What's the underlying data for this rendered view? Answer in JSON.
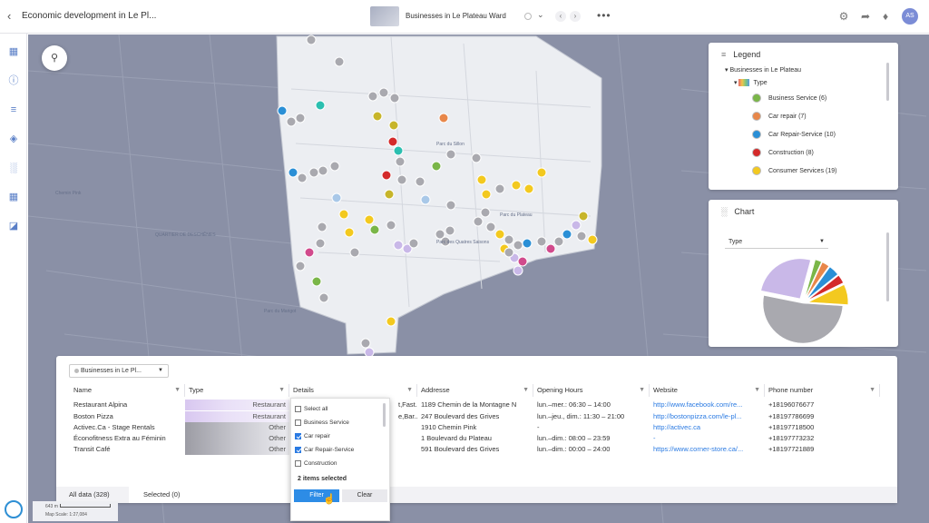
{
  "header": {
    "title": "Economic development in Le Pl...",
    "map_name": "Businesses in Le Plateau Ward",
    "user_initials": "AS"
  },
  "map": {
    "scale_distance": "643 m",
    "scale_label": "Map Scale: 1:27,084",
    "place_labels": [
      "Chemin Pink",
      "Parc du Sillon",
      "QUARTIER DE DESCHÊNES",
      "Parc du Plateau",
      "Parc des Quatres Saisons",
      "Parc du Marigot"
    ]
  },
  "legend": {
    "title": "Legend",
    "group": "Businesses in Le Plateau",
    "type_label": "Type",
    "items": [
      {
        "label": "Business Service (6)",
        "color": "#7ab648"
      },
      {
        "label": "Car repair (7)",
        "color": "#e8874a"
      },
      {
        "label": "Car Repair-Service (10)",
        "color": "#2a8fd6"
      },
      {
        "label": "Construction (8)",
        "color": "#d42a2a"
      },
      {
        "label": "Consumer Services (19)",
        "color": "#f3c91f"
      }
    ]
  },
  "chart": {
    "title": "Chart",
    "field": "Type"
  },
  "chart_data": {
    "type": "pie",
    "categories": [
      "Other",
      "Restaurant",
      "Business Service",
      "Car repair",
      "Car Repair-Service",
      "Construction",
      "Consumer Services"
    ],
    "values": [
      120,
      60,
      6,
      7,
      10,
      8,
      19
    ],
    "colors": [
      "#a9a9af",
      "#c9b8e8",
      "#7ab648",
      "#e8874a",
      "#2a8fd6",
      "#d42a2a",
      "#f3c91f"
    ]
  },
  "table": {
    "dataset": "Businesses in Le Pl...",
    "columns": [
      "Name",
      "Type",
      "Details",
      "Addresse",
      "Opening Hours",
      "Website",
      "Phone number"
    ],
    "rows": [
      {
        "name": "Restaurant Alpina",
        "type": "Restaurant",
        "details": "t,Fast...",
        "address": "1189 Chemin de la Montagne N",
        "hours": "lun.–mer.: 06:30 – 14:00",
        "website": "http://www.facebook.com/re...",
        "phone": "+18196076677"
      },
      {
        "name": "Boston Pizza",
        "type": "Restaurant",
        "details": "e,Bar...",
        "address": "247 Boulevard des Grives",
        "hours": "lun.–jeu., dim.: 11:30 – 21:00",
        "website": "http://bostonpizza.com/le-pl...",
        "phone": "+18197786699"
      },
      {
        "name": "Activec.Ca - Stage Rentals",
        "type": "Other",
        "details": "",
        "address": "1910 Chemin Pink",
        "hours": "-",
        "website": "http://activec.ca",
        "phone": "+18197718500"
      },
      {
        "name": "Éconofitness Extra au Féminin",
        "type": "Other",
        "details": "",
        "address": "1 Boulevard du Plateau",
        "hours": "lun.–dim.: 08:00 – 23:59",
        "website": "-",
        "phone": "+18197773232"
      },
      {
        "name": "Transit Café",
        "type": "Other",
        "details": "",
        "address": "591 Boulevard des Grives",
        "hours": "lun.–dim.: 00:00 – 24:00",
        "website": "https://www.corner-store.ca/...",
        "phone": "+18197721889"
      }
    ],
    "tab_all": "All data (328)",
    "tab_selected": "Selected (0)"
  },
  "filter_dropdown": {
    "options": [
      {
        "label": "Select all",
        "checked": false
      },
      {
        "label": "Business Service",
        "checked": false
      },
      {
        "label": "Car repair",
        "checked": true
      },
      {
        "label": "Car Repair-Service",
        "checked": true
      },
      {
        "label": "Construction",
        "checked": false
      }
    ],
    "selected_count": "2 items selected",
    "filter_label": "Filter",
    "clear_label": "Clear"
  },
  "icons": {
    "back": "back-arrow-icon",
    "settings": "gear-icon",
    "share": "share-icon",
    "notifications": "bell-icon"
  }
}
